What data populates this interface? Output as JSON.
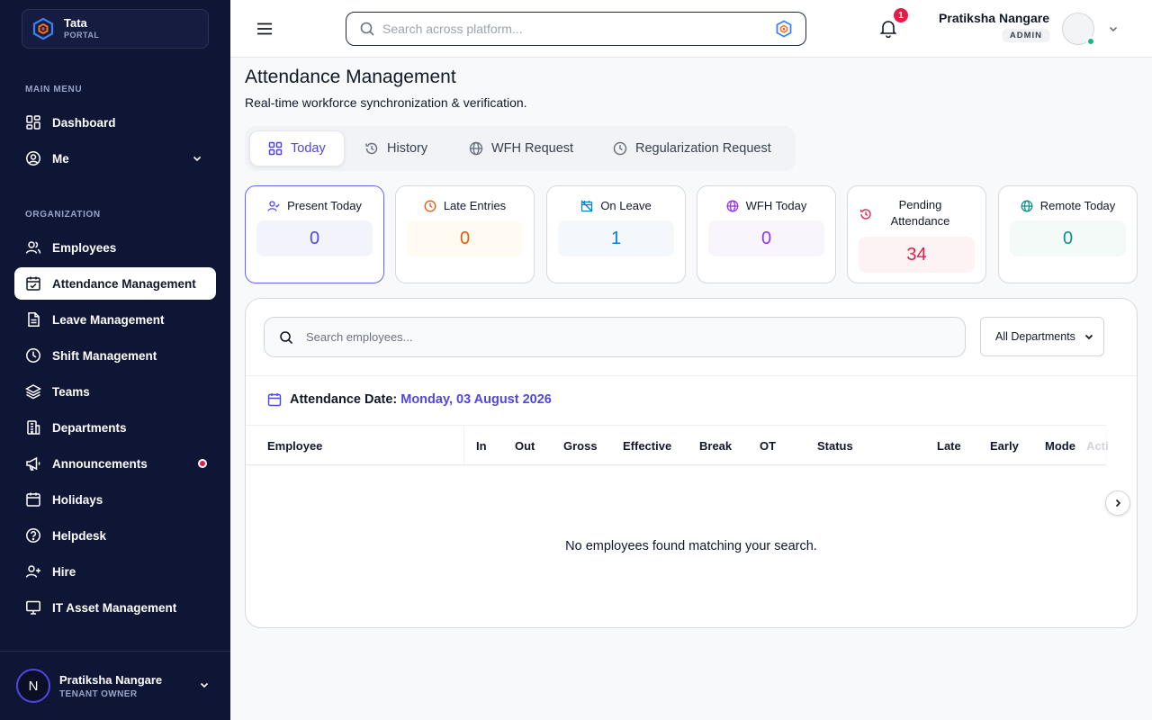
{
  "brand": {
    "name": "Tata",
    "sub": "PORTAL"
  },
  "sidebar": {
    "main_label": "MAIN MENU",
    "org_label": "ORGANIZATION",
    "main_items": [
      {
        "label": "Dashboard",
        "icon": "grid-icon"
      },
      {
        "label": "Me",
        "icon": "user-circle-icon"
      }
    ],
    "org_items": [
      {
        "label": "Employees",
        "icon": "users-icon"
      },
      {
        "label": "Attendance Management",
        "icon": "calendar-check-icon",
        "active": true
      },
      {
        "label": "Leave Management",
        "icon": "file-icon"
      },
      {
        "label": "Shift Management",
        "icon": "clock-icon"
      },
      {
        "label": "Teams",
        "icon": "layers-icon"
      },
      {
        "label": "Departments",
        "icon": "building-icon"
      },
      {
        "label": "Announcements",
        "icon": "megaphone-icon",
        "notification": true
      },
      {
        "label": "Holidays",
        "icon": "calendar-icon"
      },
      {
        "label": "Helpdesk",
        "icon": "help-circle-icon"
      },
      {
        "label": "Hire",
        "icon": "user-plus-icon"
      },
      {
        "label": "IT Asset Management",
        "icon": "monitor-icon"
      }
    ],
    "footer": {
      "initial": "N",
      "name": "Pratiksha Nangare",
      "role": "TENANT OWNER"
    }
  },
  "header": {
    "search_placeholder": "Search across platform...",
    "notifications": "1",
    "user_name": "Pratiksha Nangare",
    "user_role": "ADMIN"
  },
  "page": {
    "title": "Attendance Management",
    "subtitle": "Real-time workforce synchronization & verification."
  },
  "tabs": [
    {
      "label": "Today",
      "icon": "grid-icon",
      "active": true
    },
    {
      "label": "History",
      "icon": "history-icon"
    },
    {
      "label": "WFH Request",
      "icon": "globe-icon"
    },
    {
      "label": "Regularization Request",
      "icon": "clock-icon"
    }
  ],
  "stats": [
    {
      "label": "Present Today",
      "value": "0",
      "color": "#4f46e5",
      "bg": "#f3f4fb",
      "icon": "user-check-icon"
    },
    {
      "label": "Late Entries",
      "value": "0",
      "color": "#ea580c",
      "bg": "#fffbf3",
      "icon": "clock-icon"
    },
    {
      "label": "On Leave",
      "value": "1",
      "color": "#0284c7",
      "bg": "#f4f8fc",
      "icon": "calendar-off-icon"
    },
    {
      "label": "WFH Today",
      "value": "0",
      "color": "#9333ea",
      "bg": "#f8f6fc",
      "icon": "globe-icon"
    },
    {
      "label": "Pending Attendance",
      "value": "34",
      "color": "#e11d48",
      "bg": "#fdf2f4",
      "icon": "history-icon"
    },
    {
      "label": "Remote Today",
      "value": "0",
      "color": "#0d9488",
      "bg": "#f3faf8",
      "icon": "globe-icon"
    }
  ],
  "panel": {
    "search_placeholder": "Search employees...",
    "department_select": "All Departments",
    "date_label": "Attendance Date:",
    "date_value": "Monday, 03 August 2026",
    "columns": [
      "Employee",
      "In",
      "Out",
      "Gross",
      "Effective",
      "Break",
      "OT",
      "Status",
      "Late",
      "Early",
      "Mode",
      "Acti"
    ],
    "empty_message": "No employees found matching your search."
  }
}
